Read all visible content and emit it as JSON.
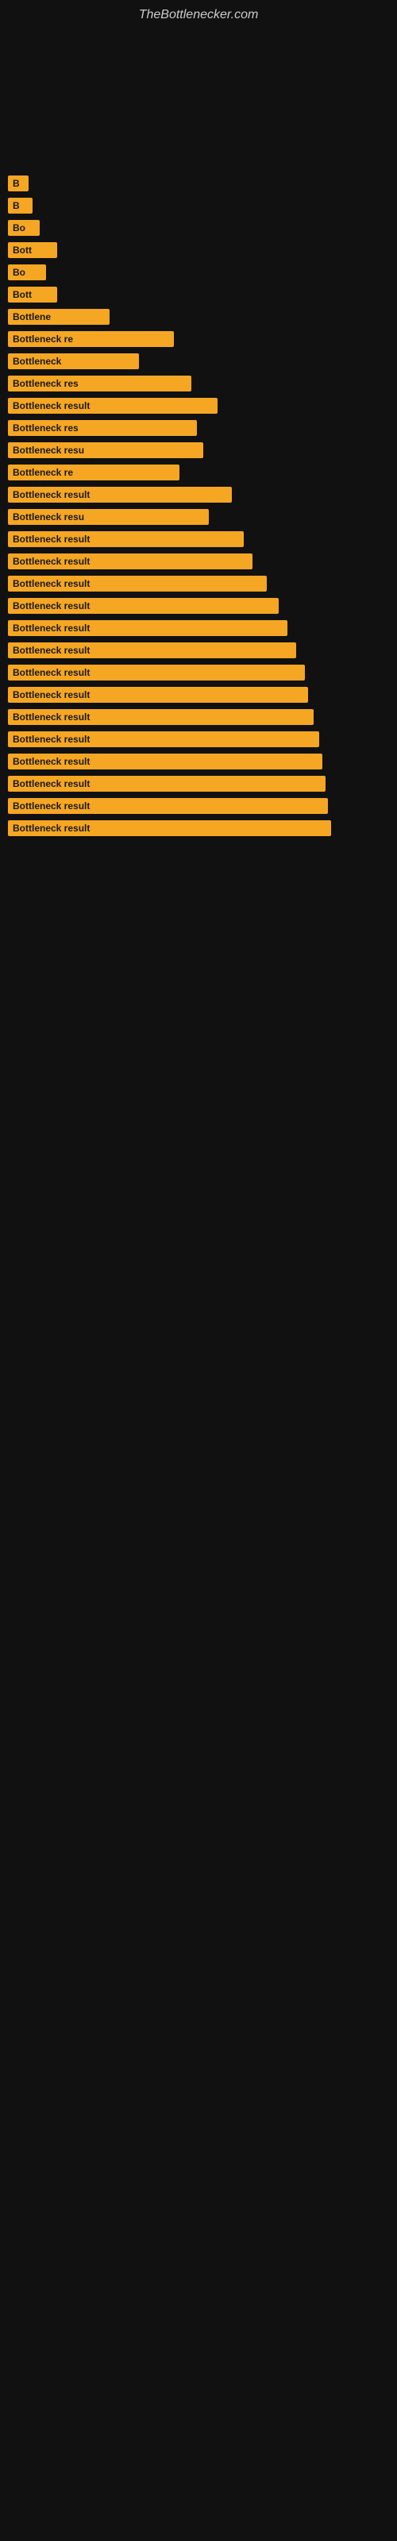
{
  "site": {
    "title": "TheBottlenecker.com"
  },
  "bars": [
    {
      "label": "",
      "width": 2
    },
    {
      "label": "",
      "width": 5
    },
    {
      "label": "",
      "width": 5
    },
    {
      "label": "",
      "width": 8
    },
    {
      "label": "",
      "width": 5
    },
    {
      "label": "",
      "width": 5
    },
    {
      "label": "B",
      "width": 12
    },
    {
      "label": "B",
      "width": 14
    },
    {
      "label": "Bo",
      "width": 18
    },
    {
      "label": "Bott",
      "width": 28
    },
    {
      "label": "Bo",
      "width": 22
    },
    {
      "label": "Bott",
      "width": 28
    },
    {
      "label": "Bottlene",
      "width": 58
    },
    {
      "label": "Bottleneck re",
      "width": 95
    },
    {
      "label": "Bottleneck",
      "width": 75
    },
    {
      "label": "Bottleneck res",
      "width": 105
    },
    {
      "label": "Bottleneck result",
      "width": 120
    },
    {
      "label": "Bottleneck res",
      "width": 108
    },
    {
      "label": "Bottleneck resu",
      "width": 112
    },
    {
      "label": "Bottleneck re",
      "width": 98
    },
    {
      "label": "Bottleneck result",
      "width": 128
    },
    {
      "label": "Bottleneck resu",
      "width": 115
    },
    {
      "label": "Bottleneck result",
      "width": 135
    },
    {
      "label": "Bottleneck result",
      "width": 140
    },
    {
      "label": "Bottleneck result",
      "width": 148
    },
    {
      "label": "Bottleneck result",
      "width": 155
    },
    {
      "label": "Bottleneck result",
      "width": 160
    },
    {
      "label": "Bottleneck result",
      "width": 165
    },
    {
      "label": "Bottleneck result",
      "width": 170
    },
    {
      "label": "Bottleneck result",
      "width": 172
    },
    {
      "label": "Bottleneck result",
      "width": 175
    },
    {
      "label": "Bottleneck result",
      "width": 178
    },
    {
      "label": "Bottleneck result",
      "width": 180
    },
    {
      "label": "Bottleneck result",
      "width": 182
    },
    {
      "label": "Bottleneck result",
      "width": 183
    },
    {
      "label": "Bottleneck result",
      "width": 185
    }
  ]
}
